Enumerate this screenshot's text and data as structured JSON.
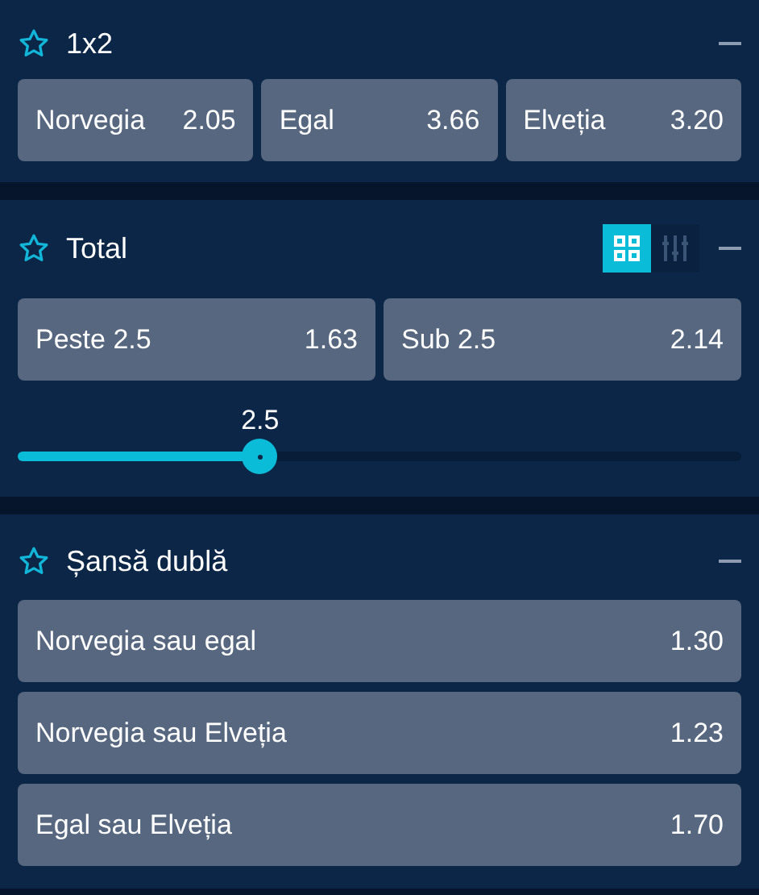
{
  "markets": [
    {
      "title": "1x2",
      "kind": "row",
      "odds": [
        {
          "label": "Norvegia",
          "price": "2.05"
        },
        {
          "label": "Egal",
          "price": "3.66"
        },
        {
          "label": "Elveția",
          "price": "3.20"
        }
      ]
    },
    {
      "title": "Total",
      "kind": "row",
      "view_modes": [
        {
          "selected": true
        },
        {
          "selected": false
        }
      ],
      "odds": [
        {
          "label": "Peste 2.5",
          "price": "1.63"
        },
        {
          "label": "Sub 2.5",
          "price": "2.14"
        }
      ],
      "slider": {
        "value": "2.5",
        "level": 0.335
      }
    },
    {
      "title": "Șansă dublă",
      "kind": "stack",
      "odds": [
        {
          "label": "Norvegia sau egal",
          "price": "1.30"
        },
        {
          "label": "Norvegia sau Elveția",
          "price": "1.23"
        },
        {
          "label": "Egal sau Elveția",
          "price": "1.70"
        }
      ]
    }
  ]
}
